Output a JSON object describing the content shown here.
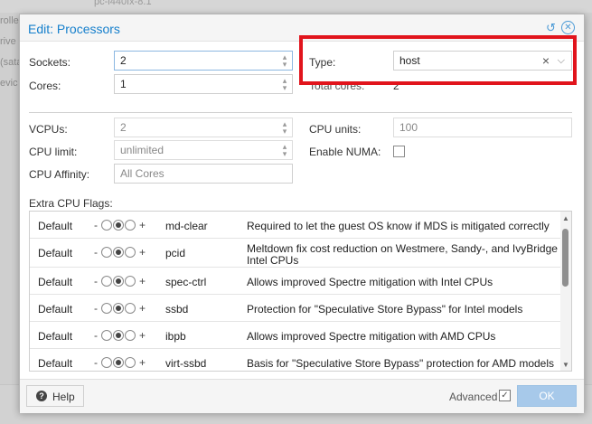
{
  "background": {
    "top_text": "pc-i440fx-8.1",
    "items": [
      "rolle",
      "rive",
      "(sata",
      "evic"
    ]
  },
  "dialog": {
    "title": "Edit: Processors",
    "icons": {
      "reset": "reset-icon",
      "close": "close-icon"
    }
  },
  "form": {
    "sockets": {
      "label": "Sockets:",
      "value": "2"
    },
    "cores": {
      "label": "Cores:",
      "value": "1"
    },
    "type": {
      "label": "Type:",
      "value": "host"
    },
    "total_cores": {
      "label": "Total cores:",
      "value": "2"
    },
    "vcpus": {
      "label": "VCPUs:",
      "value": "2"
    },
    "cpu_units": {
      "label": "CPU units:",
      "value": "100"
    },
    "cpu_limit": {
      "label": "CPU limit:",
      "value": "unlimited"
    },
    "enable_numa": {
      "label": "Enable NUMA:",
      "checked": false
    },
    "cpu_affinity": {
      "label": "CPU Affinity:",
      "placeholder": "All Cores"
    }
  },
  "flags": {
    "label": "Extra CPU Flags:",
    "rows": [
      {
        "state": "Default",
        "name": "md-clear",
        "description": "Required to let the guest OS know if MDS is mitigated correctly"
      },
      {
        "state": "Default",
        "name": "pcid",
        "description": "Meltdown fix cost reduction on Westmere, Sandy-, and IvyBridge Intel CPUs"
      },
      {
        "state": "Default",
        "name": "spec-ctrl",
        "description": "Allows improved Spectre mitigation with Intel CPUs"
      },
      {
        "state": "Default",
        "name": "ssbd",
        "description": "Protection for \"Speculative Store Bypass\" for Intel models"
      },
      {
        "state": "Default",
        "name": "ibpb",
        "description": "Allows improved Spectre mitigation with AMD CPUs"
      },
      {
        "state": "Default",
        "name": "virt-ssbd",
        "description": "Basis for \"Speculative Store Bypass\" protection for AMD models"
      }
    ],
    "minus": "-",
    "plus": "+"
  },
  "footer": {
    "help": "Help",
    "advanced": "Advanced",
    "advanced_checked": true,
    "ok": "OK"
  },
  "colors": {
    "accent": "#157fcc",
    "highlight": "#e1141c",
    "ok_disabled": "#a7c9ea"
  }
}
